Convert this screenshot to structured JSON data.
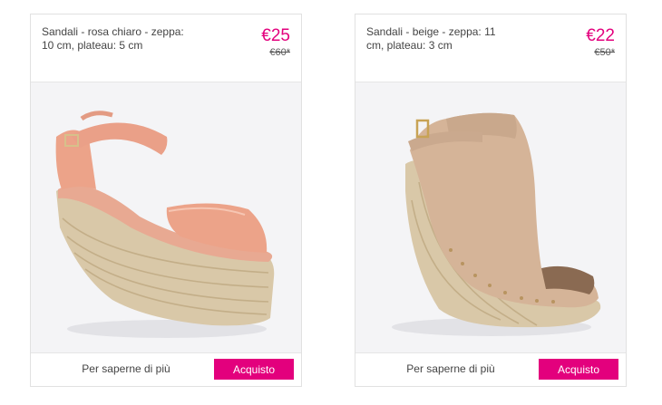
{
  "products": [
    {
      "title": "Sandali - rosa chiaro - zeppa: 10 cm, plateau: 5 cm",
      "price": "€25",
      "old_price": "€60*",
      "more_label": "Per saperne di più",
      "buy_label": "Acquisto",
      "image": "pink-espadrille-wedge-sandal"
    },
    {
      "title": "Sandali - beige - zeppa: 11 cm, plateau: 3 cm",
      "price": "€22",
      "old_price": "€50*",
      "more_label": "Per saperne di più",
      "buy_label": "Acquisto",
      "image": "beige-peep-toe-wedge-bootie"
    }
  ],
  "colors": {
    "accent": "#e3007d",
    "card_border": "#e1e1e1",
    "image_bg": "#f4f4f6"
  }
}
